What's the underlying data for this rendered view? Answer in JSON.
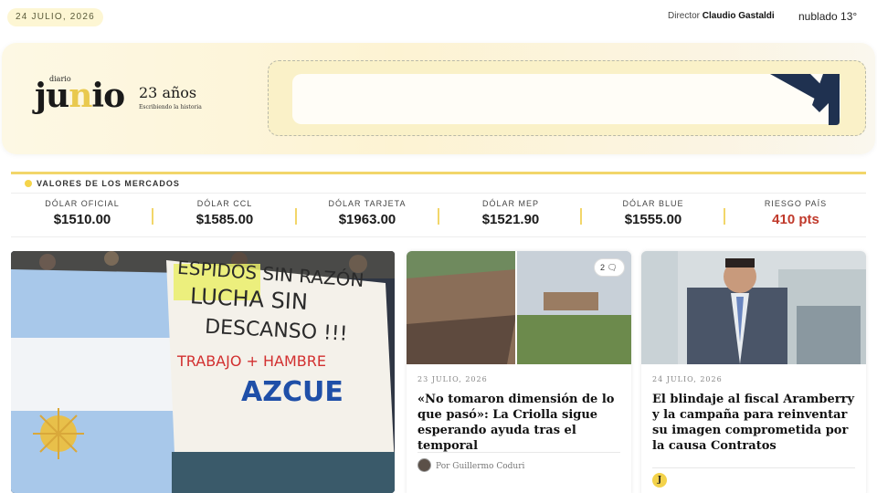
{
  "topbar": {
    "date": "24 JULIO, 2026",
    "director_label": "Director",
    "director_name": "Claudio Gastaldi",
    "weather": "nublado  13°"
  },
  "brand": {
    "prefix": "diario",
    "name_start": "ju",
    "name_accent": "n",
    "name_end": "io",
    "years": "23 años",
    "tagline": "Escribiendo la historia"
  },
  "markets": {
    "title": "VALORES DE LOS MERCADOS",
    "items": [
      {
        "label": "DÓLAR OFICIAL",
        "value": "$1510.00"
      },
      {
        "label": "DÓLAR CCL",
        "value": "$1585.00"
      },
      {
        "label": "DÓLAR TARJETA",
        "value": "$1963.00"
      },
      {
        "label": "DÓLAR MEP",
        "value": "$1521.90"
      },
      {
        "label": "DÓLAR BLUE",
        "value": "$1555.00"
      },
      {
        "label": "RIESGO PAÍS",
        "value": "410 pts"
      }
    ]
  },
  "main_photo": {
    "banner_lines": [
      "ESPIDOS SIN RAZÓN",
      "LUCHA SIN",
      "DESCANSO !!!",
      "TRABAJO + HAMBRE",
      "AZCUE"
    ]
  },
  "articles": [
    {
      "date": "23 JULIO, 2026",
      "title": "«No tomaron dimensión de lo que pasó»: La Criolla sigue esperando ayuda tras el temporal",
      "author": "Por Guillermo Coduri",
      "comments": "2"
    },
    {
      "date": "24 JULIO, 2026",
      "title": "El blindaje al fiscal Aramberry y la campaña para reinventar su imagen comprometida por la causa Contratos",
      "badge": "J"
    }
  ],
  "colors": {
    "accent": "#f2d66a",
    "risk": "#c0392b",
    "banner": "#fdf3d3"
  }
}
